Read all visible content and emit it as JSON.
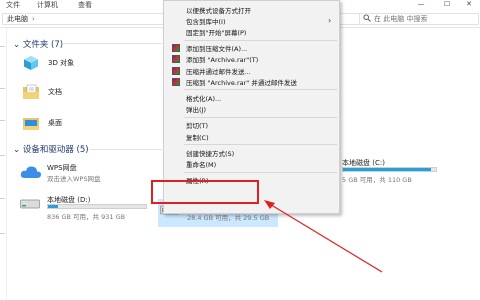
{
  "window": {
    "menu_tabs": [
      "文件",
      "计算机",
      "查看"
    ],
    "minimize": "—",
    "maximize": "☐",
    "close": "✕"
  },
  "address": {
    "crumb": "此电脑",
    "chevron": "›",
    "search_placeholder": "在 此电脑 中搜索"
  },
  "folders_group": {
    "title": "文件夹 (7)",
    "items": [
      {
        "label": "3D 对象",
        "icon": "3d-objects-icon"
      },
      {
        "label": "文档",
        "icon": "documents-icon"
      },
      {
        "label": "桌面",
        "icon": "desktop-folder-icon"
      }
    ]
  },
  "devices_group": {
    "title": "设备和驱动器 (5)",
    "drives": [
      {
        "name": "WPS网盘",
        "sub": "双击进入WPS网盘",
        "icon": "wps-cloud-icon"
      },
      {
        "name": "本地磁盘 (D:)",
        "sub": "836 GB 可用，共 931 GB",
        "used_fraction": 0.1,
        "icon": "hard-drive-icon"
      },
      {
        "name": "",
        "sub": "28.4 GB 可用，共 29.5 GB",
        "used_fraction": 0.04,
        "icon": "usb-drive-icon"
      },
      {
        "name": "本地磁盘 (C:)",
        "sub": "5 GB 可用，共 110 GB",
        "used_fraction": 0.95,
        "icon": "hard-drive-icon"
      }
    ]
  },
  "context_menu": {
    "items": [
      {
        "label": "以便携式设备方式打开",
        "type": "item"
      },
      {
        "label": "包含到库中(I)",
        "type": "submenu"
      },
      {
        "label": "固定到\"开始\"屏幕(P)",
        "type": "item"
      },
      {
        "type": "sep"
      },
      {
        "label": "添加到压缩文件(A)...",
        "type": "item",
        "icon": "winrar-icon"
      },
      {
        "label": "添加到 \"Archive.rar\"(T)",
        "type": "item",
        "icon": "winrar-icon"
      },
      {
        "label": "压缩并通过邮件发送...",
        "type": "item",
        "icon": "winrar-icon"
      },
      {
        "label": "压缩到 \"Archive.rar\" 并通过邮件发送",
        "type": "item",
        "icon": "winrar-icon"
      },
      {
        "type": "sep"
      },
      {
        "label": "格式化(A)...",
        "type": "item"
      },
      {
        "label": "弹出(J)",
        "type": "item"
      },
      {
        "type": "sep"
      },
      {
        "label": "剪切(T)",
        "type": "item"
      },
      {
        "label": "复制(C)",
        "type": "item"
      },
      {
        "type": "sep"
      },
      {
        "label": "创建快捷方式(S)",
        "type": "item"
      },
      {
        "label": "重命名(M)",
        "type": "item"
      },
      {
        "type": "sep"
      },
      {
        "label": "属性(R)",
        "type": "item"
      }
    ],
    "submenu_arrow": "›"
  },
  "colors": {
    "accent_blue": "#26a0da",
    "highlight_red": "#e02020",
    "selection_bg": "#cce8ff",
    "menu_bg": "#f2f2f2"
  }
}
